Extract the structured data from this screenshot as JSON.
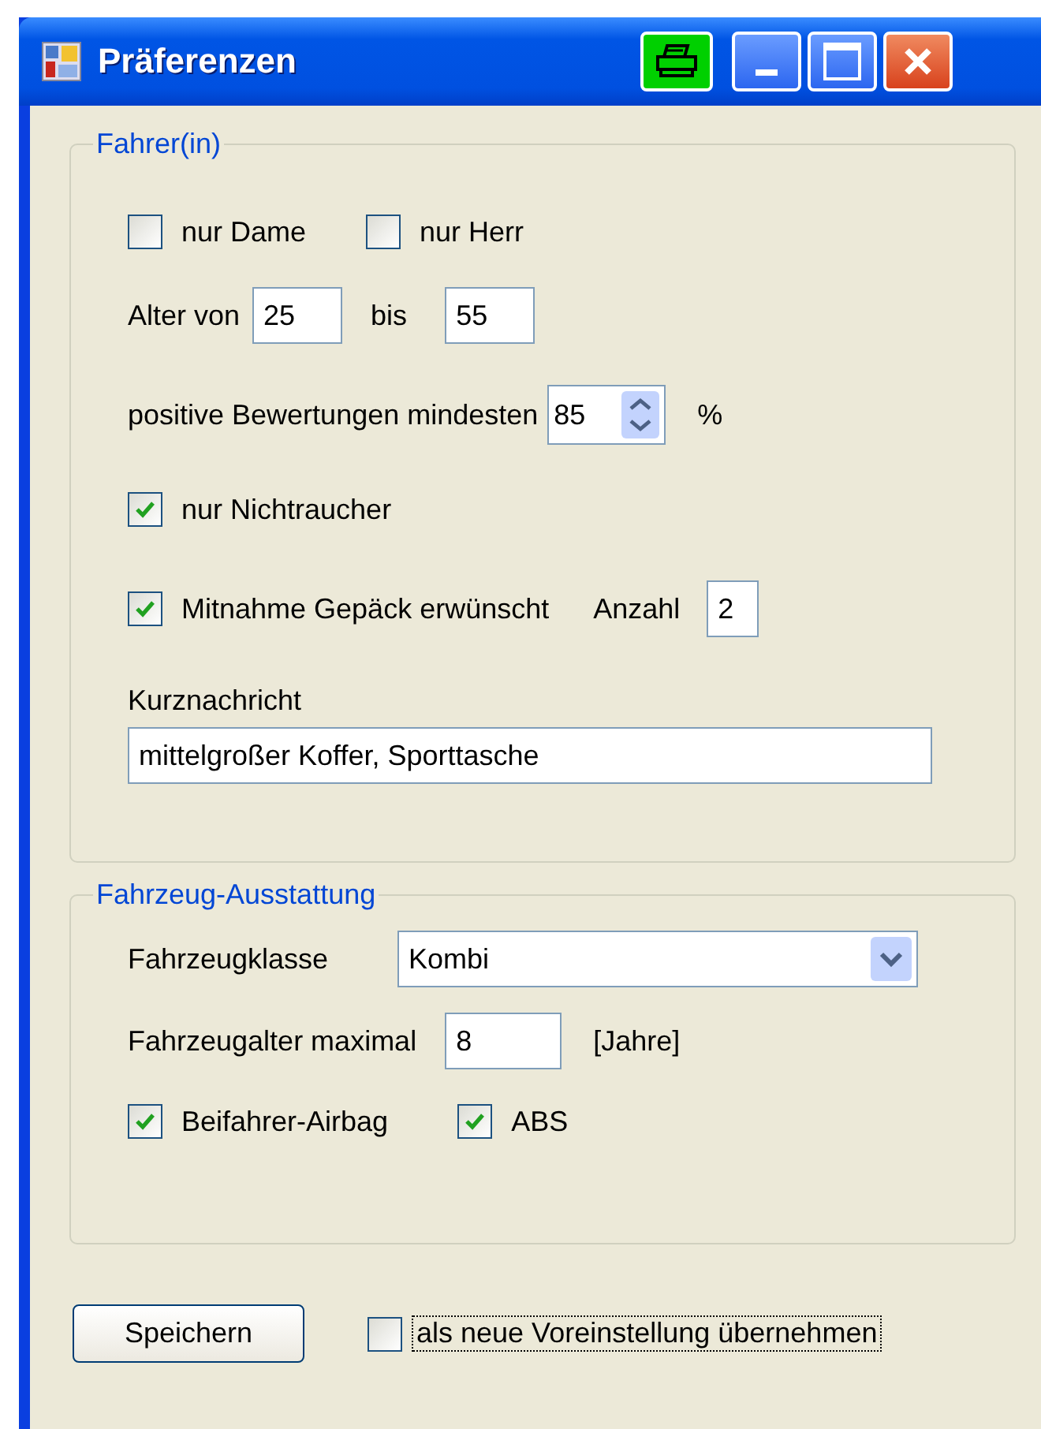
{
  "window": {
    "title": "Präferenzen"
  },
  "driver_group": {
    "legend": "Fahrer(in)",
    "gender_options": [
      {
        "label": "nur Dame",
        "checked": false
      },
      {
        "label": "nur Herr",
        "checked": false
      }
    ],
    "age": {
      "label_from": "Alter von",
      "from": "25",
      "label_to": "bis",
      "to": "55"
    },
    "rating": {
      "label": "positive Bewertungen mindesten",
      "value": "85",
      "unit": "%"
    },
    "non_smoker": {
      "label": "nur Nichtraucher",
      "checked": true
    },
    "luggage": {
      "label": "Mitnahme Gepäck erwünscht",
      "checked": true,
      "count_label": "Anzahl",
      "count": "2"
    },
    "message": {
      "label": "Kurznachricht",
      "value": "mittelgroßer Koffer, Sporttasche"
    }
  },
  "vehicle_group": {
    "legend": "Fahrzeug-Ausstattung",
    "vehicle_class": {
      "label": "Fahrzeugklasse",
      "value": "Kombi"
    },
    "max_age": {
      "label": "Fahrzeugalter maximal",
      "value": "8",
      "unit": "[Jahre]"
    },
    "features": [
      {
        "label": "Beifahrer-Airbag",
        "checked": true
      },
      {
        "label": "ABS",
        "checked": true
      }
    ]
  },
  "footer": {
    "save_button": "Speichern",
    "default_option": {
      "label": "als neue Voreinstellung übernehmen",
      "checked": false,
      "focused": true
    }
  }
}
